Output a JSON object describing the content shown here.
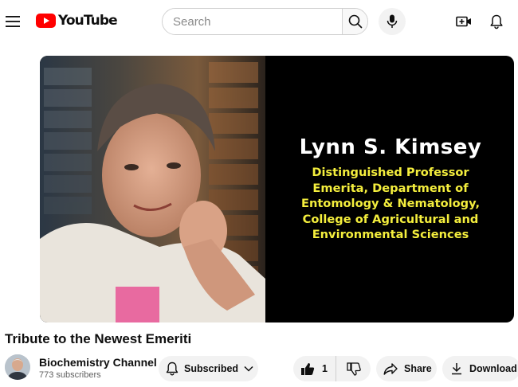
{
  "header": {
    "brand": "YouTube",
    "search_placeholder": "Search"
  },
  "video": {
    "overlay_name": "Lynn S. Kimsey",
    "overlay_lines": [
      "Distinguished Professor",
      "Emerita, Department of",
      "Entomology & Nematology,",
      "College of Agricultural and",
      "Environmental Sciences"
    ],
    "title": "Tribute to the Newest Emeriti"
  },
  "channel": {
    "name": "Biochemistry Channel",
    "subscribers": "773 subscribers"
  },
  "actions": {
    "subscribed_label": "Subscribed",
    "like_count": "1",
    "share_label": "Share",
    "download_label": "Download"
  },
  "colors": {
    "brand_red": "#ff0000",
    "overlay_yellow": "#f4ee3d",
    "pill_bg": "#f2f2f2"
  }
}
